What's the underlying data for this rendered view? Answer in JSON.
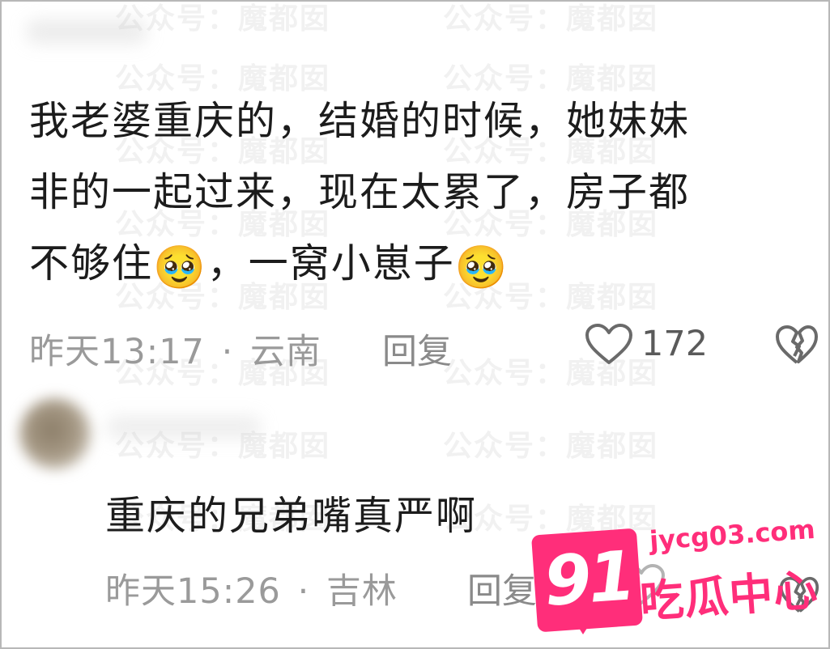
{
  "watermark": {
    "text": "公众号：魔都囡"
  },
  "comments": [
    {
      "text_lines": [
        "我老婆重庆的，结婚的时候，她妹妹",
        "非的一起过来，现在太累了，房子都",
        "不够住"
      ],
      "mid_text": "，一窝小崽子",
      "emoji": "🥹",
      "time": "昨天13:17",
      "separator": "·",
      "location": "云南",
      "reply_label": "回复",
      "likes": "172"
    },
    {
      "text": "重庆的兄弟嘴真严啊",
      "time": "昨天15:26",
      "separator": "·",
      "location": "吉林",
      "reply_label": "回复"
    }
  ],
  "logo": {
    "number": "91",
    "url": "jycg03.com",
    "name": "吃瓜中心",
    "color": "#ff2e7a"
  }
}
